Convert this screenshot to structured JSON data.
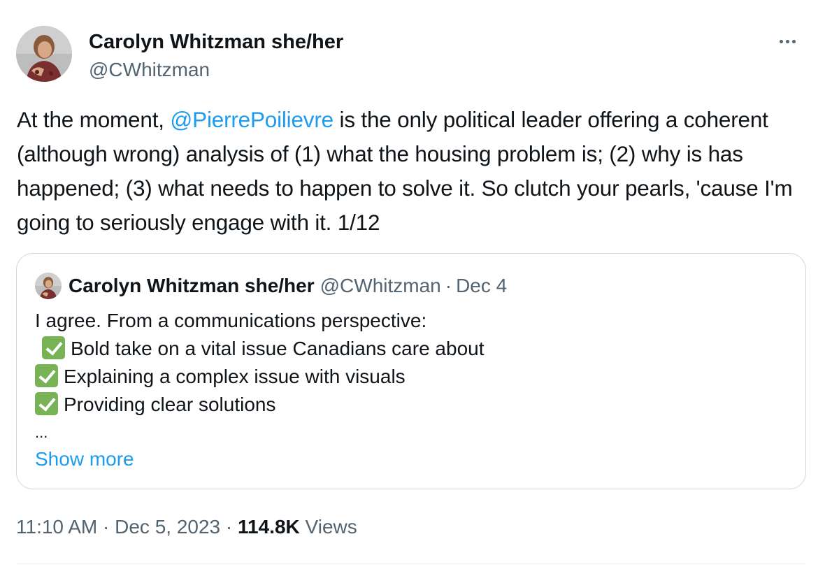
{
  "author": {
    "display_name": "Carolyn Whitzman she/her",
    "handle": "@CWhitzman"
  },
  "tweet": {
    "text_before_mention": "At the moment, ",
    "mention": "@PierrePoilievre",
    "text_after_mention": " is the only political leader offering a coherent (although wrong) analysis of (1) what the housing problem is; (2) why is has happened; (3) what needs to happen to solve it. So clutch your pearls, 'cause I'm going to seriously engage with it. 1/12"
  },
  "quote": {
    "display_name": "Carolyn Whitzman she/her",
    "handle": "@CWhitzman",
    "separator": "·",
    "date": "Dec 4",
    "intro": "I agree. From a communications perspective:",
    "items": [
      "Bold take on a vital issue Canadians care about",
      "Explaining a complex issue with visuals",
      "Providing clear solutions"
    ],
    "ellipsis": "...",
    "show_more": "Show more"
  },
  "meta": {
    "time": "11:10 AM",
    "sep1": "·",
    "date": "Dec 5, 2023",
    "sep2": "·",
    "views_count": "114.8K",
    "views_label": "Views"
  },
  "icons": {
    "more": "more-horizontal-icon",
    "check": "white-check-mark-icon"
  },
  "colors": {
    "link": "#1d9bf0",
    "secondary_text": "#536471",
    "primary_text": "#0f1419",
    "border": "#cfd9de",
    "check_green": "#77b255"
  }
}
